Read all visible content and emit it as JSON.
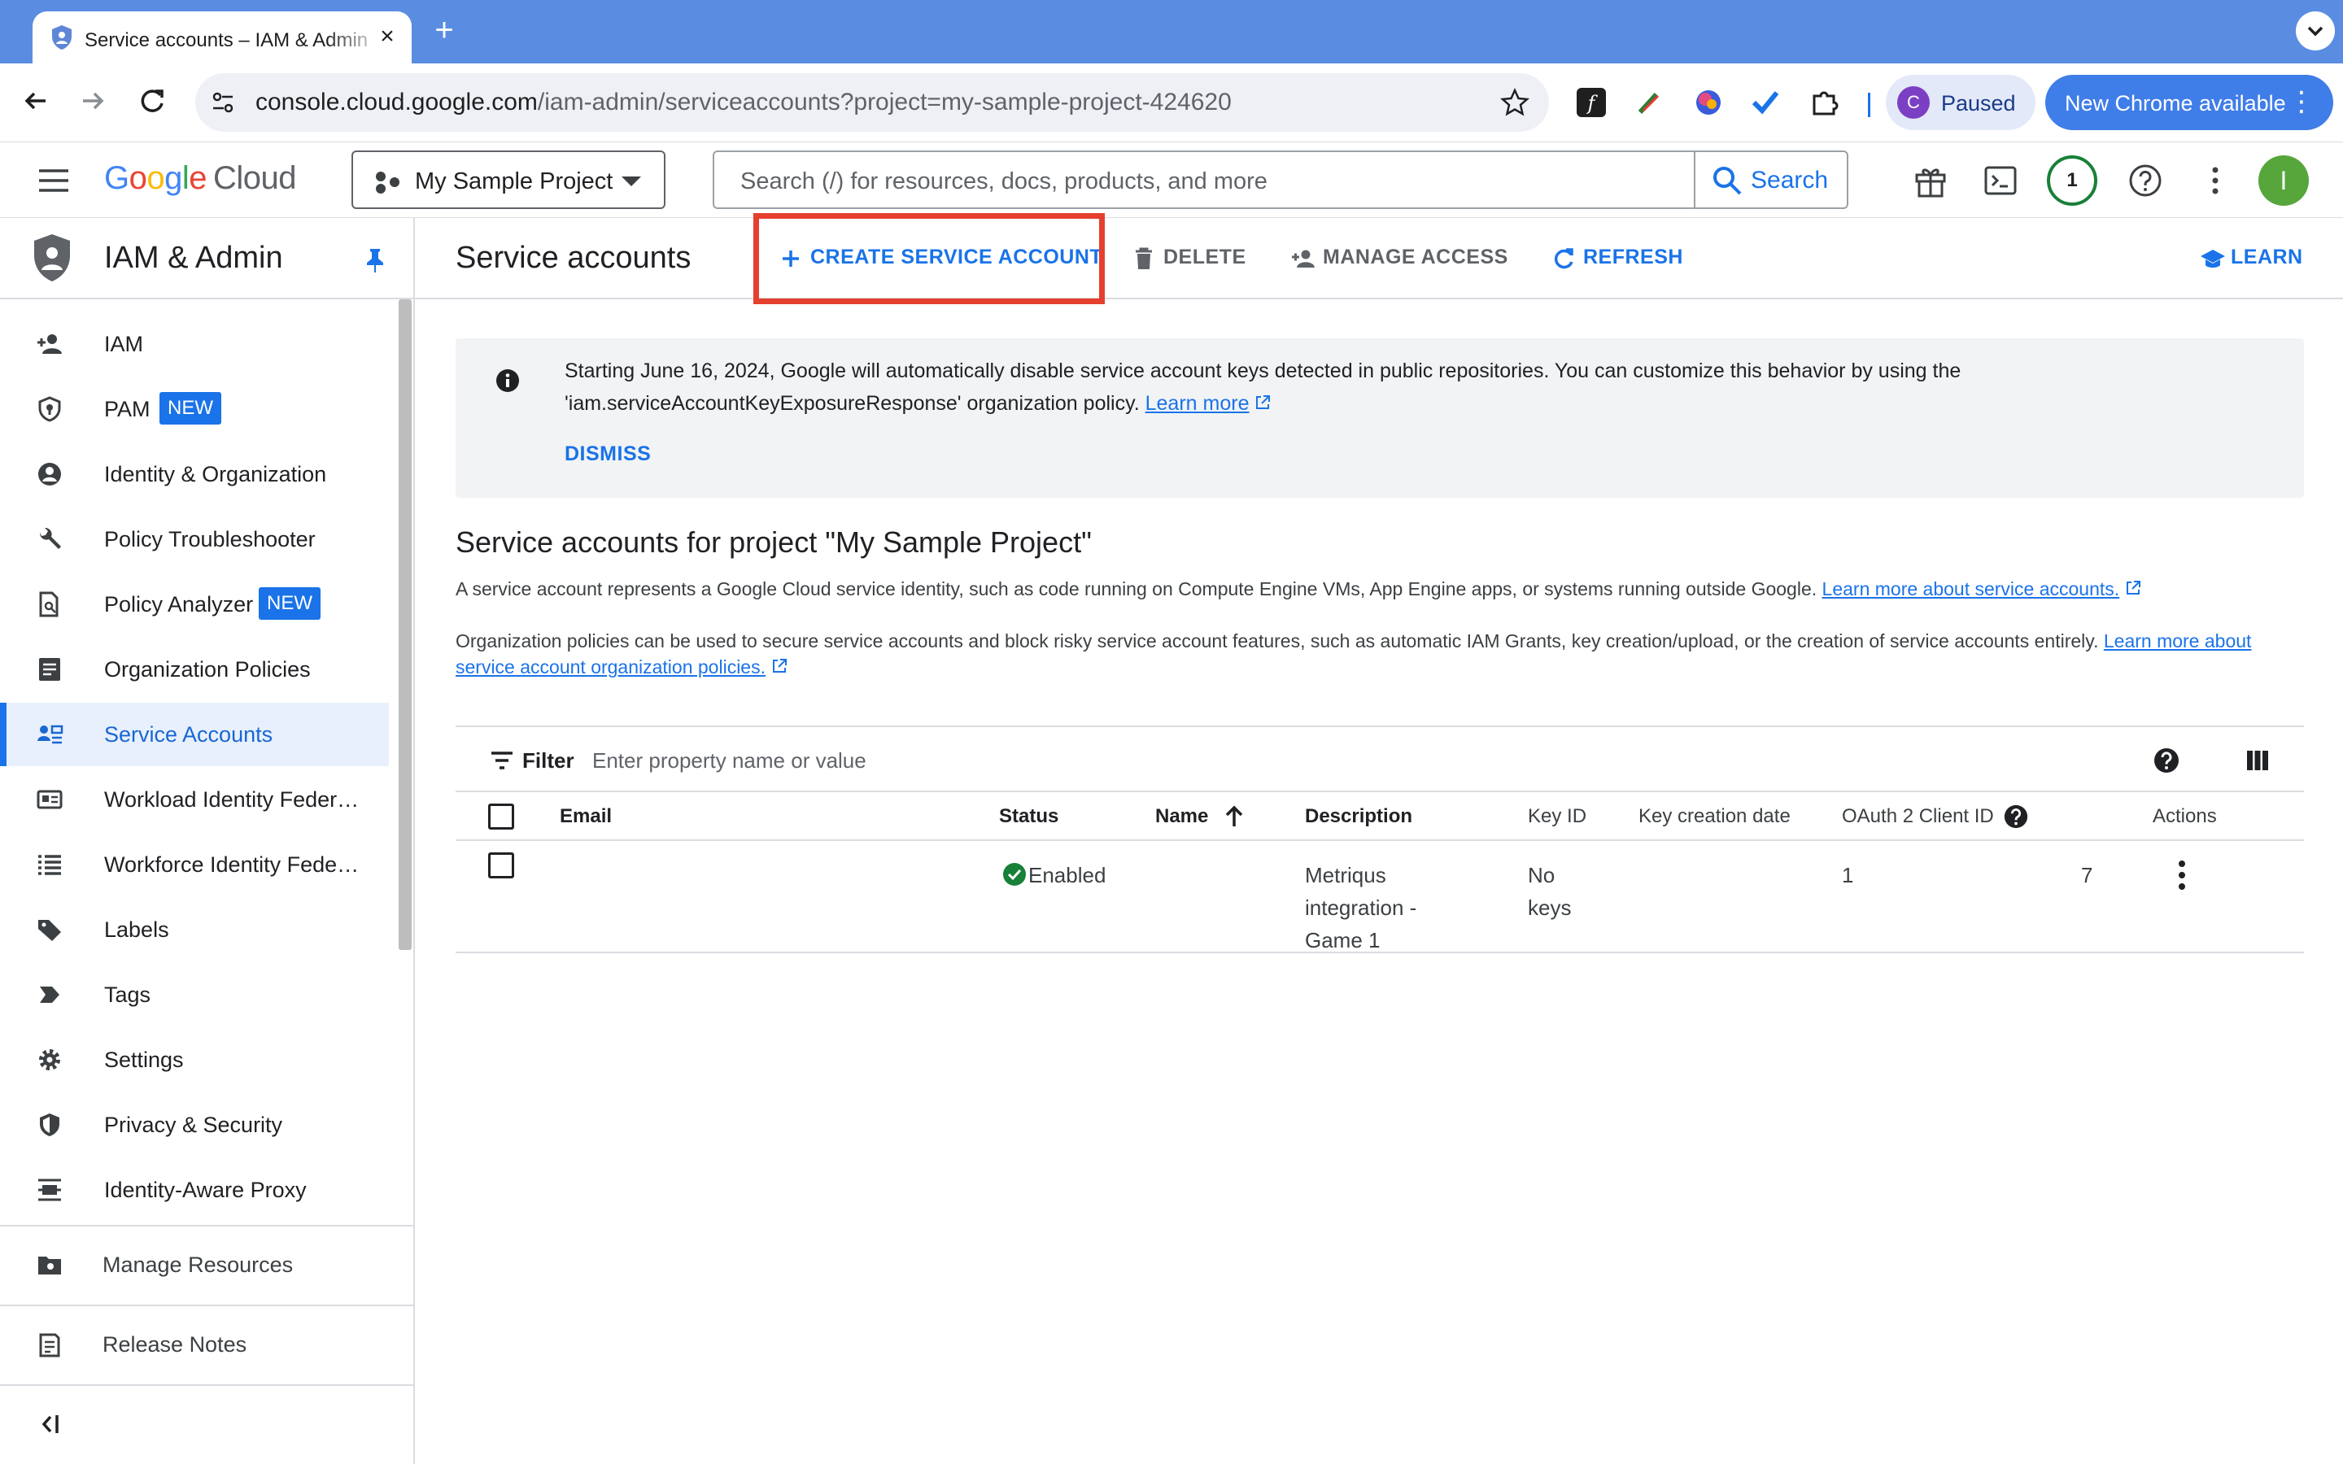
{
  "browser": {
    "tab_title": "Service accounts – IAM & Admin",
    "url_host": "console.cloud.google.com",
    "url_path": "/iam-admin/serviceaccounts?project=my-sample-project-424620",
    "profile_initial": "C",
    "profile_status": "Paused",
    "update_label": "New Chrome available"
  },
  "header": {
    "logo_google": [
      "G",
      "o",
      "o",
      "g",
      "l",
      "e"
    ],
    "logo_cloud": "Cloud",
    "project_name": "My Sample Project",
    "search_placeholder": "Search (/) for resources, docs, products, and more",
    "search_button": "Search",
    "notification_count": "1",
    "user_initial": "I"
  },
  "sidebar": {
    "title": "IAM & Admin",
    "items": [
      {
        "label": "IAM",
        "icon": "person-add-icon"
      },
      {
        "label": "PAM",
        "icon": "shield-key-icon",
        "badge": "NEW"
      },
      {
        "label": "Identity & Organization",
        "icon": "account-circle-icon"
      },
      {
        "label": "Policy Troubleshooter",
        "icon": "wrench-icon"
      },
      {
        "label": "Policy Analyzer",
        "icon": "document-search-icon",
        "badge": "NEW"
      },
      {
        "label": "Organization Policies",
        "icon": "list-document-icon"
      },
      {
        "label": "Service Accounts",
        "icon": "service-account-icon",
        "active": true
      },
      {
        "label": "Workload Identity Federat...",
        "icon": "id-card-icon"
      },
      {
        "label": "Workforce Identity Federa...",
        "icon": "list-icon"
      },
      {
        "label": "Labels",
        "icon": "label-icon"
      },
      {
        "label": "Tags",
        "icon": "tag-arrow-icon"
      },
      {
        "label": "Settings",
        "icon": "gear-icon"
      },
      {
        "label": "Privacy & Security",
        "icon": "shield-icon"
      },
      {
        "label": "Identity-Aware Proxy",
        "icon": "proxy-icon"
      }
    ],
    "manage_resources": "Manage Resources",
    "release_notes": "Release Notes"
  },
  "actions": {
    "page_title": "Service accounts",
    "create": "CREATE SERVICE ACCOUNT",
    "delete": "DELETE",
    "manage_access": "MANAGE ACCESS",
    "refresh": "REFRESH",
    "learn": "LEARN"
  },
  "banner": {
    "text": "Starting June 16, 2024, Google will automatically disable service account keys detected in public repositories. You can customize this behavior by using the 'iam.serviceAccountKeyExposureResponse' organization policy.",
    "link": "Learn more",
    "dismiss": "DISMISS"
  },
  "content": {
    "section_title": "Service accounts for project \"My Sample Project\"",
    "para1": "A service account represents a Google Cloud service identity, such as code running on Compute Engine VMs, App Engine apps, or systems running outside Google.",
    "para1_link": "Learn more about service accounts.",
    "para2": "Organization policies can be used to secure service accounts and block risky service account features, such as automatic IAM Grants, key creation/upload, or the creation of service accounts entirely.",
    "para2_link": "Learn more about service account organization policies."
  },
  "table": {
    "filter_label": "Filter",
    "filter_placeholder": "Enter property name or value",
    "columns": [
      "Email",
      "Status",
      "Name",
      "Description",
      "Key ID",
      "Key creation date",
      "OAuth 2 Client ID",
      "Actions"
    ],
    "rows": [
      {
        "email": "",
        "status": "Enabled",
        "name": "",
        "description": "Metriqus integration - Game 1",
        "key_id": "No keys",
        "key_creation_date": "",
        "oauth_client_id_start": "1",
        "oauth_client_id_end": "7"
      }
    ]
  },
  "colors": {
    "accent": "#1a73e8",
    "highlight": "#e5402f",
    "status_ok": "#188038"
  }
}
